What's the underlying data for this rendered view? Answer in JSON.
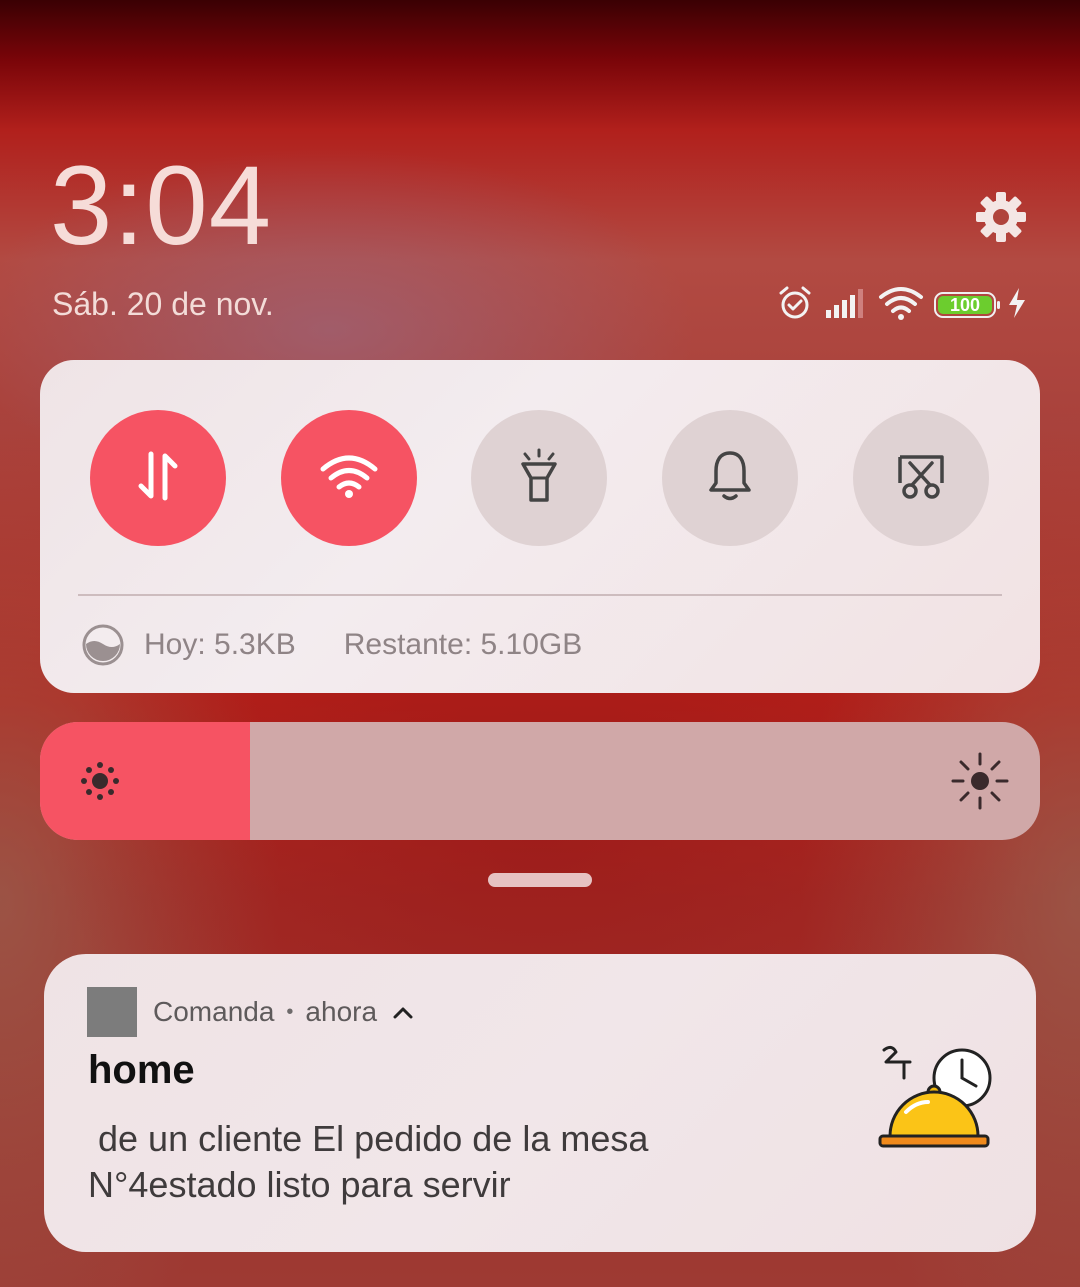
{
  "header": {
    "time": "3:04",
    "date": "Sáb. 20 de nov."
  },
  "status_bar": {
    "icons": [
      "alarm-icon",
      "cellular-signal-icon",
      "wifi-icon",
      "battery-icon",
      "charging-bolt-icon"
    ],
    "battery_level": "100",
    "battery_color": "#6ccd2e"
  },
  "quick_settings": {
    "toggles": [
      {
        "name": "mobile-data",
        "icon": "data-arrows-icon",
        "state": "on"
      },
      {
        "name": "wifi",
        "icon": "wifi-icon",
        "state": "on"
      },
      {
        "name": "flashlight",
        "icon": "flashlight-icon",
        "state": "off"
      },
      {
        "name": "sound",
        "icon": "bell-icon",
        "state": "off"
      },
      {
        "name": "screenshot",
        "icon": "scissors-screenshot-icon",
        "state": "off"
      }
    ],
    "usage_today": "Hoy: 5.3KB",
    "usage_remaining": "Restante: 5.10GB",
    "accent": "#f65363"
  },
  "brightness": {
    "level": 0.21,
    "min_icon": "sun-dim-icon",
    "max_icon": "sun-bright-icon"
  },
  "notification": {
    "app_name": "Comanda",
    "separator": "•",
    "time": "ahora",
    "title": "home",
    "body": " de un cliente El pedido de la mesa\nN°4estado listo para servir",
    "image": "serving-cloche-clock-icon"
  }
}
